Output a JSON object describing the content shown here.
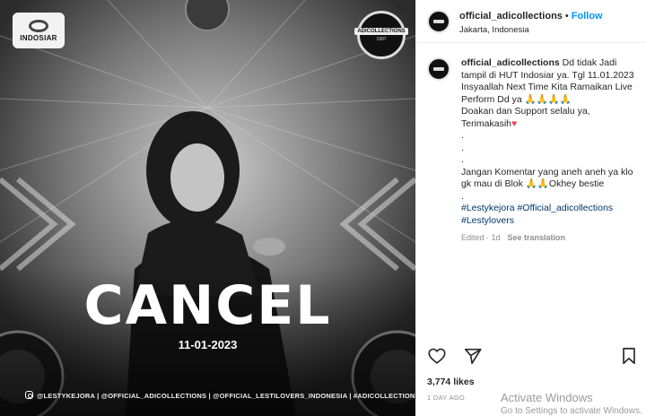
{
  "media": {
    "channel_logo": "INDOSIAR",
    "seal_text": "ADICOLLECTIONS",
    "seal_year": "1997",
    "headline": "CANCEL",
    "date": "11-01-2023",
    "credits": "@LESTYKEJORA | @OFFICIAL_ADICOLLECTIONS | @OFFICIAL_LESTILOVERS_INDONESIA | #ADICOLLECTIONS"
  },
  "header": {
    "username": "official_adicollections",
    "separator": "•",
    "follow_label": "Follow",
    "location": "Jakarta, Indonesia"
  },
  "caption": {
    "username": "official_adicollections",
    "lines": [
      "Dd tidak Jadi tampil di HUT Indosiar ya. Tgl 11.01.2023",
      "Insyaallah Next Time Kita Ramaikan Live Perform Dd ya 🙏🙏🙏🙏",
      "Doakan dan Support selalu ya, Terimakasih",
      ".",
      ".",
      ".",
      "Jangan Komentar yang aneh aneh ya klo gk mau di Blok 🙏🙏Okhey bestie",
      "."
    ],
    "heart": "♥",
    "hashtags": [
      "#Lestykejora #Official_adicollections",
      "#Lestylovers"
    ],
    "edited": "Edited · 1d",
    "see_translation": "See translation"
  },
  "actions": {
    "like_icon": "heart-outline-icon",
    "share_icon": "paper-plane-icon",
    "save_icon": "bookmark-icon"
  },
  "likes": "3,774 likes",
  "time_ago": "1 DAY AGO",
  "watermark": {
    "title": "Activate Windows",
    "subtitle": "Go to Settings to activate Windows."
  }
}
